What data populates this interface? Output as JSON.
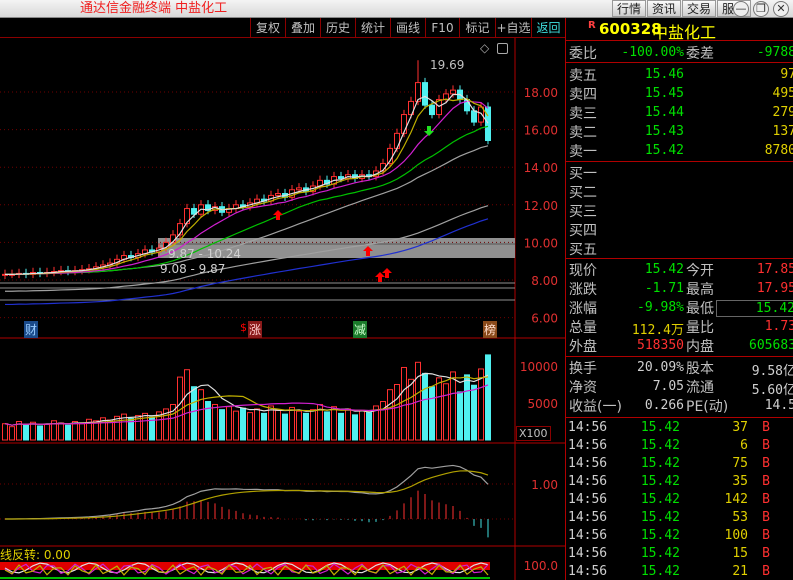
{
  "app": {
    "title": "通达信金融终端  中盐化工",
    "menu": [
      "行情",
      "资讯",
      "交易",
      "服务"
    ],
    "window_buttons": [
      "—",
      "❐",
      "✕"
    ]
  },
  "toolbar": [
    "复权",
    "叠加",
    "历史",
    "统计",
    "画线",
    "F10",
    "标记",
    "+自选",
    "返回"
  ],
  "stock": {
    "badge": "R",
    "code": "600328",
    "name": "中盐化工"
  },
  "order_ratio": {
    "label1": "委比",
    "value1": "-100.00%",
    "label2": "委差",
    "value2": "-9788"
  },
  "asks": [
    {
      "label": "卖五",
      "price": "15.46",
      "vol": "97"
    },
    {
      "label": "卖四",
      "price": "15.45",
      "vol": "495"
    },
    {
      "label": "卖三",
      "price": "15.44",
      "vol": "279"
    },
    {
      "label": "卖二",
      "price": "15.43",
      "vol": "137"
    },
    {
      "label": "卖一",
      "price": "15.42",
      "vol": "8780"
    }
  ],
  "bids": [
    {
      "label": "买一"
    },
    {
      "label": "买二"
    },
    {
      "label": "买三"
    },
    {
      "label": "买四"
    },
    {
      "label": "买五"
    }
  ],
  "quote": [
    {
      "l1": "现价",
      "v1": "15.42",
      "c1": "g",
      "l2": "今开",
      "v2": "17.85",
      "c2": "r"
    },
    {
      "l1": "涨跌",
      "v1": "-1.71",
      "c1": "g",
      "l2": "最高",
      "v2": "17.95",
      "c2": "r"
    },
    {
      "l1": "涨幅",
      "v1": "-9.98%",
      "c1": "g",
      "l2": "最低",
      "v2": "15.42",
      "c2": "g"
    },
    {
      "l1": "总量",
      "v1": "112.4万",
      "c1": "y",
      "l2": "量比",
      "v2": "1.73",
      "c2": "r"
    },
    {
      "l1": "外盘",
      "v1": "518350",
      "c1": "r",
      "l2": "内盘",
      "v2": "605683",
      "c2": "g"
    }
  ],
  "fundamentals": [
    {
      "l1": "换手",
      "v1": "20.09%",
      "l2": "股本",
      "v2": "9.58亿"
    },
    {
      "l1": "净资",
      "v1": "7.05",
      "l2": "流通",
      "v2": "5.60亿"
    },
    {
      "l1": "收益(一)",
      "v1": "0.266",
      "l2": "PE(动)",
      "v2": "14.5"
    }
  ],
  "ticks": [
    {
      "t": "14:56",
      "p": "15.42",
      "v": "37",
      "s": "B"
    },
    {
      "t": "14:56",
      "p": "15.42",
      "v": "6",
      "s": "B"
    },
    {
      "t": "14:56",
      "p": "15.42",
      "v": "75",
      "s": "B"
    },
    {
      "t": "14:56",
      "p": "15.42",
      "v": "35",
      "s": "B"
    },
    {
      "t": "14:56",
      "p": "15.42",
      "v": "142",
      "s": "B"
    },
    {
      "t": "14:56",
      "p": "15.42",
      "v": "53",
      "s": "B"
    },
    {
      "t": "14:56",
      "p": "15.42",
      "v": "100",
      "s": "B"
    },
    {
      "t": "14:56",
      "p": "15.42",
      "v": "15",
      "s": "B"
    },
    {
      "t": "14:56",
      "p": "15.42",
      "v": "21",
      "s": "B"
    }
  ],
  "chart_labels": {
    "high": "19.69",
    "band1": "9.87 - 10.24",
    "band2": "9.08 - 9.87",
    "markers": [
      "财",
      "涨",
      "减",
      "榜"
    ],
    "vol_unit": "X100",
    "indicator": "线反转: 0.00"
  },
  "chart_data": {
    "type": "candlestick",
    "price_ticks": [
      18,
      16,
      14,
      12,
      10,
      8,
      6
    ],
    "price_tick_labels": [
      "18.00",
      "16.00",
      "14.00",
      "12.00",
      "10.00",
      "8.00",
      "6.00"
    ],
    "vol_ticks": [
      10000,
      5000
    ],
    "vol_tick_labels": [
      "10000",
      "5000"
    ],
    "macd_ticks": [
      1
    ],
    "macd_tick_labels": [
      "1.00"
    ],
    "ind_ticks": [
      100
    ],
    "ind_tick_labels": [
      "100.0"
    ],
    "close": [
      8.3,
      8.3,
      8.35,
      8.3,
      8.4,
      8.35,
      8.4,
      8.45,
      8.5,
      8.45,
      8.5,
      8.55,
      8.6,
      8.7,
      8.8,
      8.9,
      9.1,
      9.3,
      9.2,
      9.4,
      9.6,
      9.5,
      9.7,
      10.0,
      10.4,
      11.0,
      11.8,
      11.5,
      12.0,
      11.7,
      11.9,
      11.6,
      11.8,
      12.0,
      11.9,
      12.1,
      12.3,
      12.2,
      12.5,
      12.6,
      12.4,
      12.8,
      12.9,
      12.7,
      13.0,
      13.3,
      13.1,
      13.5,
      13.4,
      13.6,
      13.4,
      13.6,
      13.5,
      13.8,
      14.2,
      15.0,
      15.8,
      16.8,
      17.5,
      18.5,
      17.3,
      16.8,
      17.6,
      17.9,
      18.1,
      17.6,
      17.0,
      16.4,
      17.2,
      15.42
    ],
    "volume": [
      2200,
      1800,
      2500,
      2000,
      2400,
      1900,
      2100,
      2600,
      2300,
      2000,
      2500,
      2200,
      2800,
      2600,
      3000,
      2700,
      3200,
      3500,
      2900,
      3300,
      3600,
      3100,
      3800,
      4200,
      4800,
      8500,
      9500,
      7200,
      6800,
      5200,
      4800,
      4100,
      4500,
      3900,
      4300,
      3700,
      4200,
      3600,
      4600,
      4000,
      3500,
      4400,
      3900,
      3600,
      4100,
      4800,
      3800,
      4500,
      3600,
      4200,
      3400,
      4000,
      3700,
      4600,
      5200,
      6800,
      7500,
      9800,
      8200,
      10500,
      9000,
      7200,
      8400,
      7600,
      9200,
      6500,
      8800,
      7400,
      9600,
      11500
    ]
  }
}
